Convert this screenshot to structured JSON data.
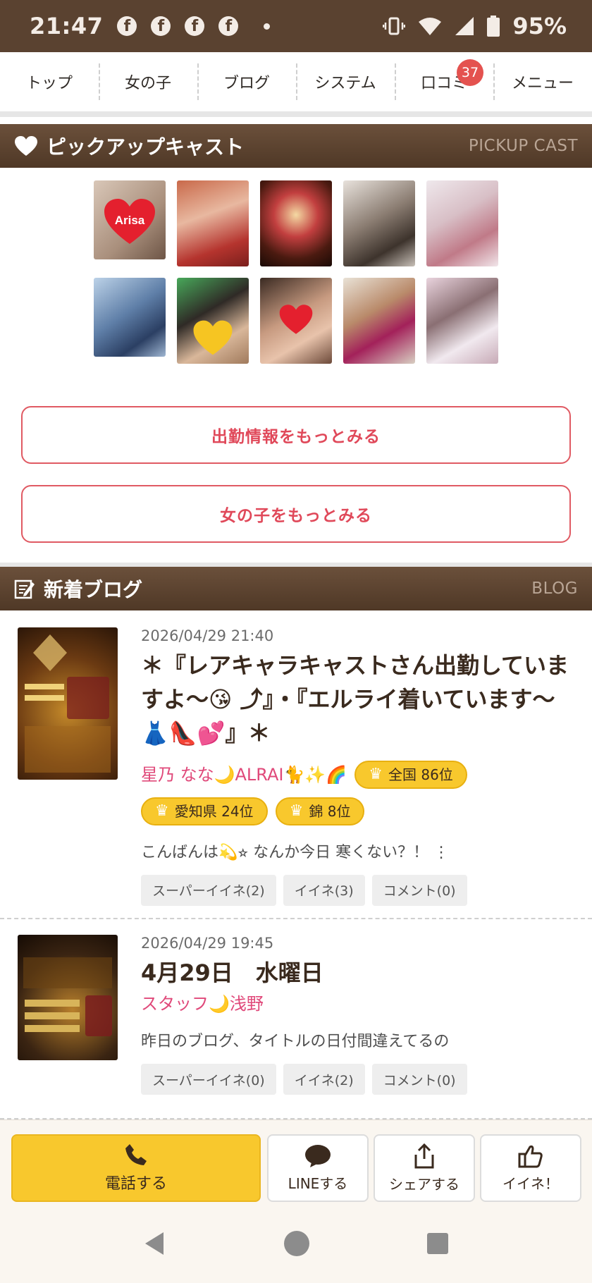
{
  "status_bar": {
    "time": "21:47",
    "notifications": [
      "facebook-icon",
      "facebook-icon",
      "facebook-icon",
      "facebook-icon"
    ],
    "battery": "95%"
  },
  "nav": {
    "items": [
      {
        "label": "トップ"
      },
      {
        "label": "女の子"
      },
      {
        "label": "ブログ"
      },
      {
        "label": "システム"
      },
      {
        "label": "口コミ",
        "badge": "37"
      },
      {
        "label": "メニュー"
      }
    ]
  },
  "pickup": {
    "title": "ピックアップキャスト",
    "title_en": "PICKUP CAST",
    "first_cast_label": "Arisa"
  },
  "buttons": {
    "more_schedule": "出勤情報をもっとみる",
    "more_girls": "女の子をもっとみる"
  },
  "blog": {
    "title": "新着ブログ",
    "title_en": "BLOG",
    "posts": [
      {
        "date": "2026/04/29 21:40",
        "title": "＊『レアキャラキャストさん出勤していますよ〜😘 ⤴︎』・『エルライ着いています〜👗👠💕』＊",
        "author": "星乃 なな🌙ALRAI🐈✨🌈",
        "ranks": [
          "全国 86位",
          "愛知県 24位",
          "錦 8位"
        ],
        "excerpt": "こんばんは💫⭐︎ なんか今日 寒くない？！ ⋮",
        "reactions": {
          "super": "スーパーイイネ(2)",
          "like": "イイネ(3)",
          "comment": "コメント(0)"
        }
      },
      {
        "date": "2026/04/29 19:45",
        "title": "4月29日　水曜日",
        "author": "スタッフ🌙浅野",
        "excerpt": "昨日のブログ、タイトルの日付間違えてるの",
        "reactions": {
          "super": "スーパーイイネ(0)",
          "like": "イイネ(2)",
          "comment": "コメント(0)"
        }
      }
    ]
  },
  "actions": {
    "call": "電話する",
    "line": "LINEする",
    "share": "シェアする",
    "like": "イイネ！"
  },
  "colors": {
    "brand_brown": "#5a4230",
    "accent_pink": "#e0495a",
    "gold": "#f8c82d"
  }
}
